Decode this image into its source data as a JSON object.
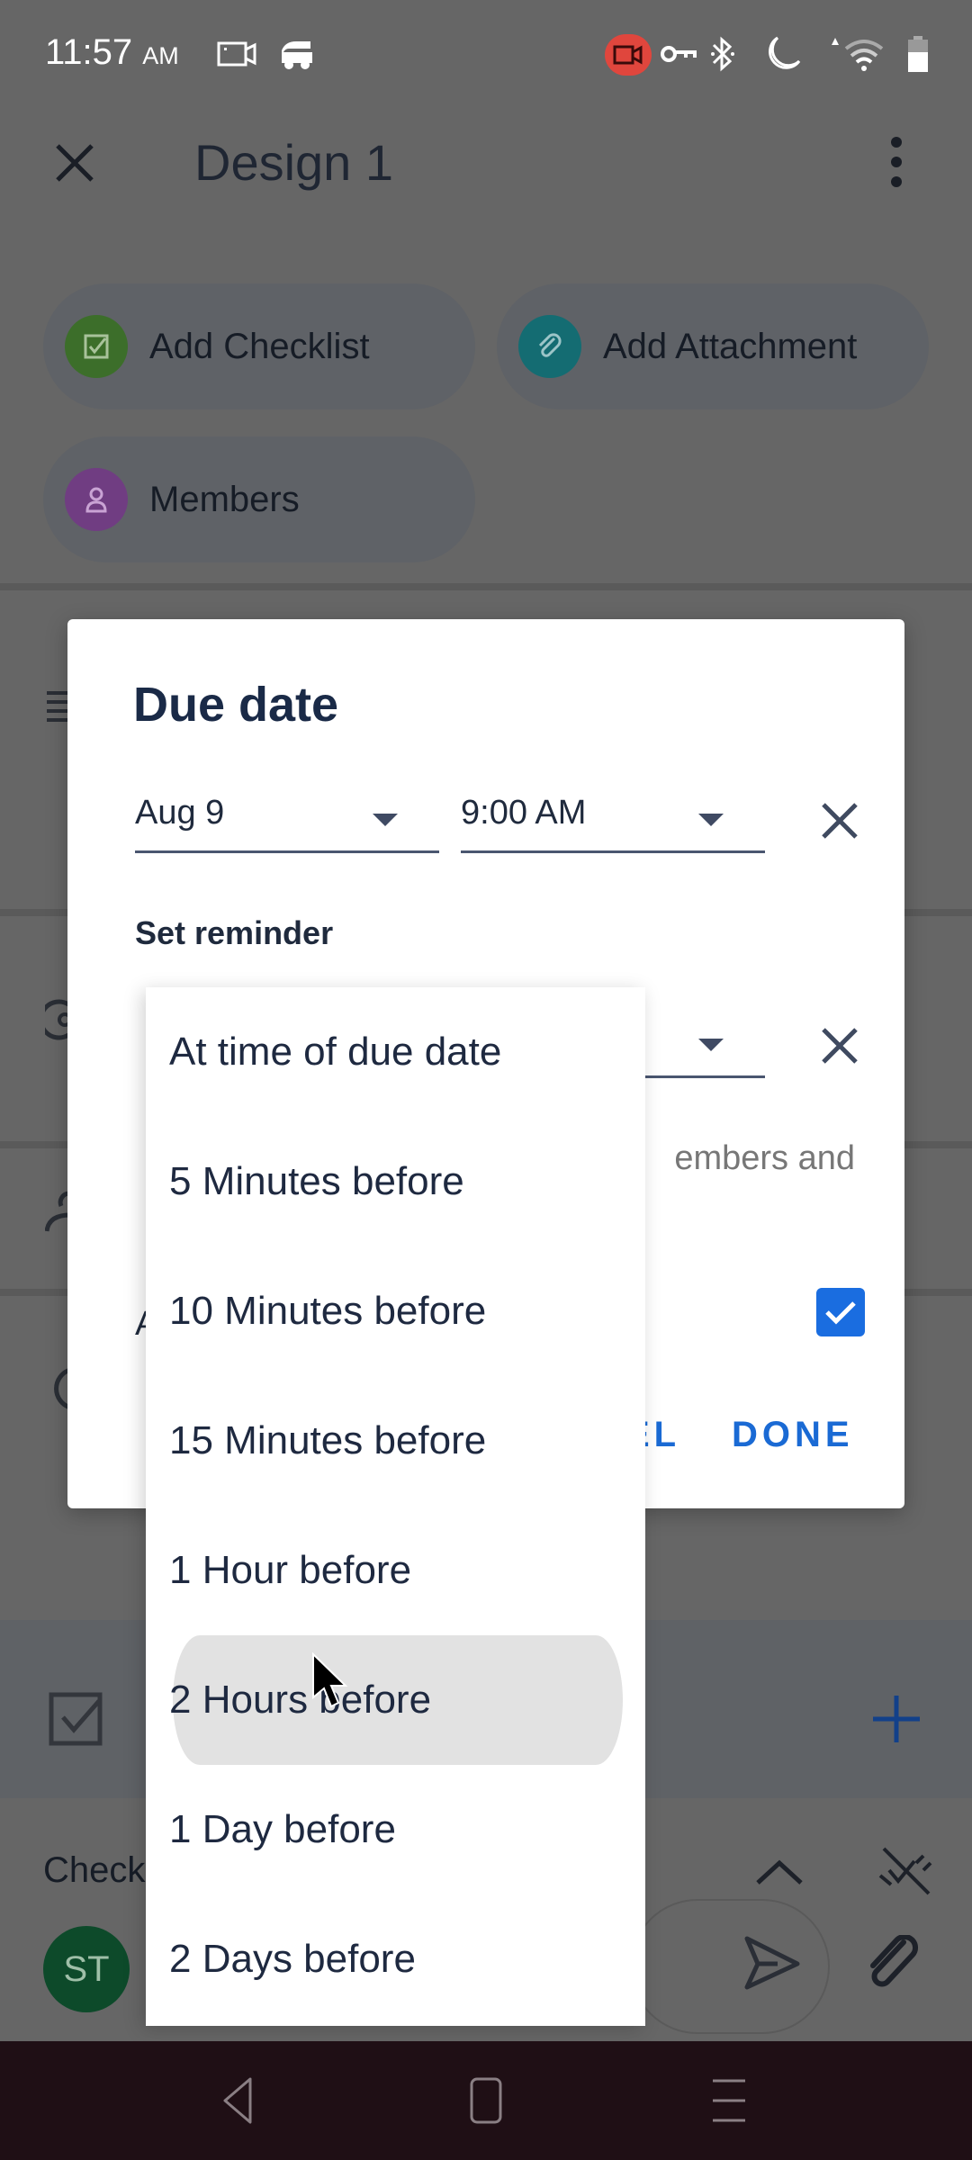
{
  "status_bar": {
    "time": "11:57",
    "ampm": "AM",
    "icons": [
      "screen-record-icon",
      "car-icon",
      "recording-indicator-icon",
      "vpn-key-icon",
      "bluetooth-icon",
      "do-not-disturb-moon-icon",
      "wifi-icon",
      "battery-icon"
    ]
  },
  "app_bar": {
    "title": "Design 1",
    "close_icon": "close-icon",
    "more_icon": "more-vert-icon"
  },
  "quick_actions": [
    {
      "label": "Add Checklist",
      "icon": "checklist-icon",
      "color": "#3c7a2b"
    },
    {
      "label": "Add Attachment",
      "icon": "attachment-icon",
      "color": "#0f7b80"
    },
    {
      "label": "Members",
      "icon": "person-icon",
      "color": "#7a3f8c"
    }
  ],
  "background": {
    "checklist_section_label": "Check",
    "avatar_initials": "ST",
    "avatar_color": "#0d4a2a",
    "add_color": "#0d3f8f"
  },
  "dialog": {
    "title": "Due date",
    "date_value": "Aug 9",
    "time_value": "9:00 AM",
    "reminder_label": "Set reminder",
    "helper_text_visible": "embers and",
    "row_label_visible": "A",
    "checkbox_checked": true,
    "cancel_visible": "EL",
    "done_label": "DONE",
    "accent": "#1a6ad4"
  },
  "reminder_menu": {
    "options": [
      "At time of due date",
      "5 Minutes before",
      "10 Minutes before",
      "15 Minutes before",
      "1 Hour before",
      "2 Hours before",
      "1 Day before",
      "2 Days before"
    ],
    "hovered_index": 5
  },
  "nav_bar": {
    "buttons": [
      "back-icon",
      "home-icon",
      "recents-menu-icon"
    ]
  }
}
